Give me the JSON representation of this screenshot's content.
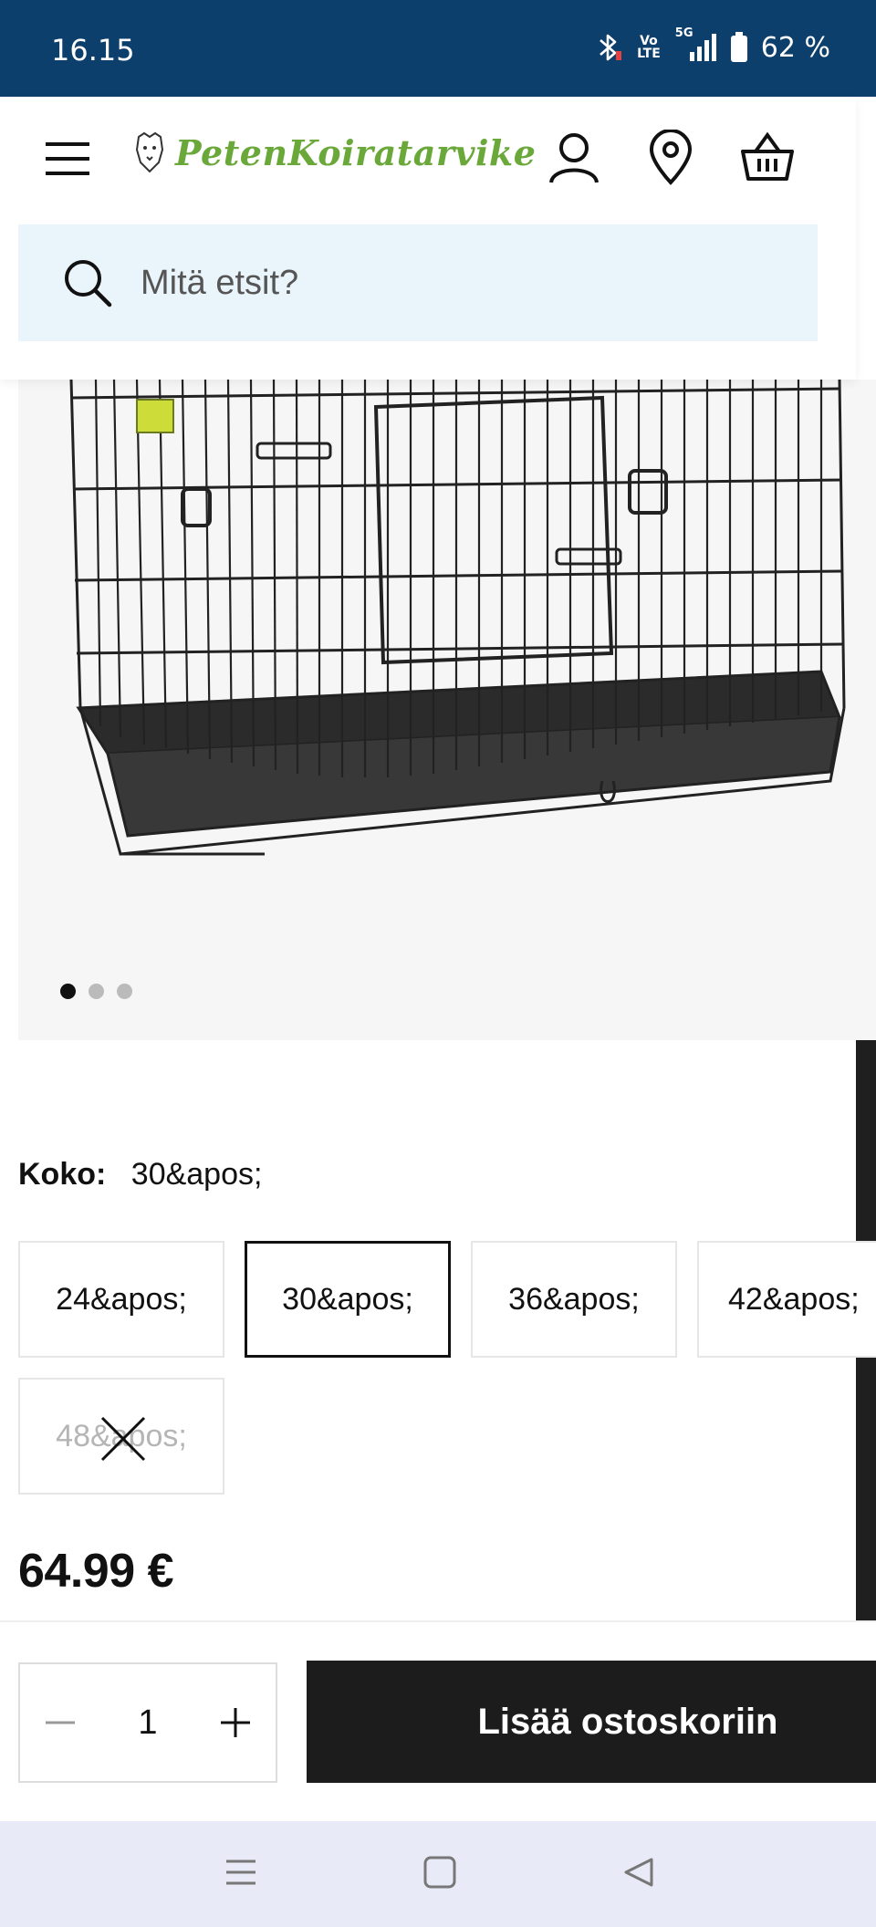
{
  "status_bar": {
    "time": "16.15",
    "volte_top": "Vo",
    "volte_bottom": "LTE",
    "network": "5G",
    "battery": "62 %"
  },
  "header": {
    "logo_text": "PetenKoiratarvike",
    "search_placeholder": "Mitä etsit?"
  },
  "gallery": {
    "slide_count": 3,
    "active_slide": 1
  },
  "size_selector": {
    "label": "Koko:",
    "selected_value": "30&apos;",
    "options": [
      {
        "label": "24&apos;",
        "state": "available"
      },
      {
        "label": "30&apos;",
        "state": "selected"
      },
      {
        "label": "36&apos;",
        "state": "available"
      },
      {
        "label": "42&apos;",
        "state": "available"
      },
      {
        "label": "48&apos;",
        "state": "unavailable"
      }
    ]
  },
  "price": "64.99 €",
  "cart": {
    "quantity": "1",
    "add_to_cart_label": "Lisää ostoskoriin"
  },
  "colors": {
    "status_bar": "#0d3f6c",
    "logo_green": "#6aa83a",
    "search_bg": "#e9f4fb",
    "button_dark": "#1c1c1c"
  }
}
